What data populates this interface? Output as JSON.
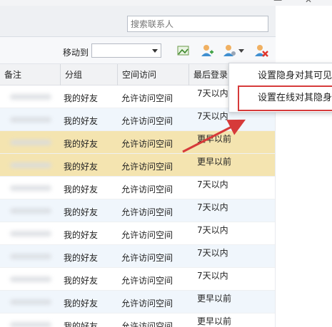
{
  "search": {
    "placeholder": "搜索联系人"
  },
  "toolbar": {
    "move_label": "移动到",
    "move_value": "",
    "icons": [
      "image-icon",
      "add-user-icon",
      "user-settings-icon",
      "delete-user-icon"
    ]
  },
  "table": {
    "headers": [
      "备注",
      "分组",
      "空间访问",
      "最后登录"
    ],
    "rows": [
      {
        "group": "我的好友",
        "space": "允许访问空间",
        "last": "7天以内",
        "style": "normal"
      },
      {
        "group": "我的好友",
        "space": "允许访问空间",
        "last": "7天以内",
        "style": "alt"
      },
      {
        "group": "我的好友",
        "space": "允许访问空间",
        "last": "更早以前",
        "style": "hl"
      },
      {
        "group": "我的好友",
        "space": "允许访问空间",
        "last": "更早以前",
        "style": "hl"
      },
      {
        "group": "我的好友",
        "space": "允许访问空间",
        "last": "7天以内",
        "style": "normal"
      },
      {
        "group": "我的好友",
        "space": "允许访问空间",
        "last": "7天以内",
        "style": "alt"
      },
      {
        "group": "我的好友",
        "space": "允许访问空间",
        "last": "7天以内",
        "style": "normal"
      },
      {
        "group": "我的好友",
        "space": "允许访问空间",
        "last": "7天以内",
        "style": "alt"
      },
      {
        "group": "我的好友",
        "space": "允许访问空间",
        "last": "7天以内",
        "style": "normal"
      },
      {
        "group": "我的好友",
        "space": "允许访问空间",
        "last": "更早以前",
        "style": "alt"
      },
      {
        "group": "我的好友",
        "space": "允许访问空间",
        "last": "更早以前",
        "style": "normal"
      }
    ]
  },
  "menu": {
    "items": [
      "设置隐身对其可见",
      "设置在线对其隐身"
    ]
  },
  "colors": {
    "highlight": "#f4e4b0",
    "annotation": "#d63a3a"
  }
}
